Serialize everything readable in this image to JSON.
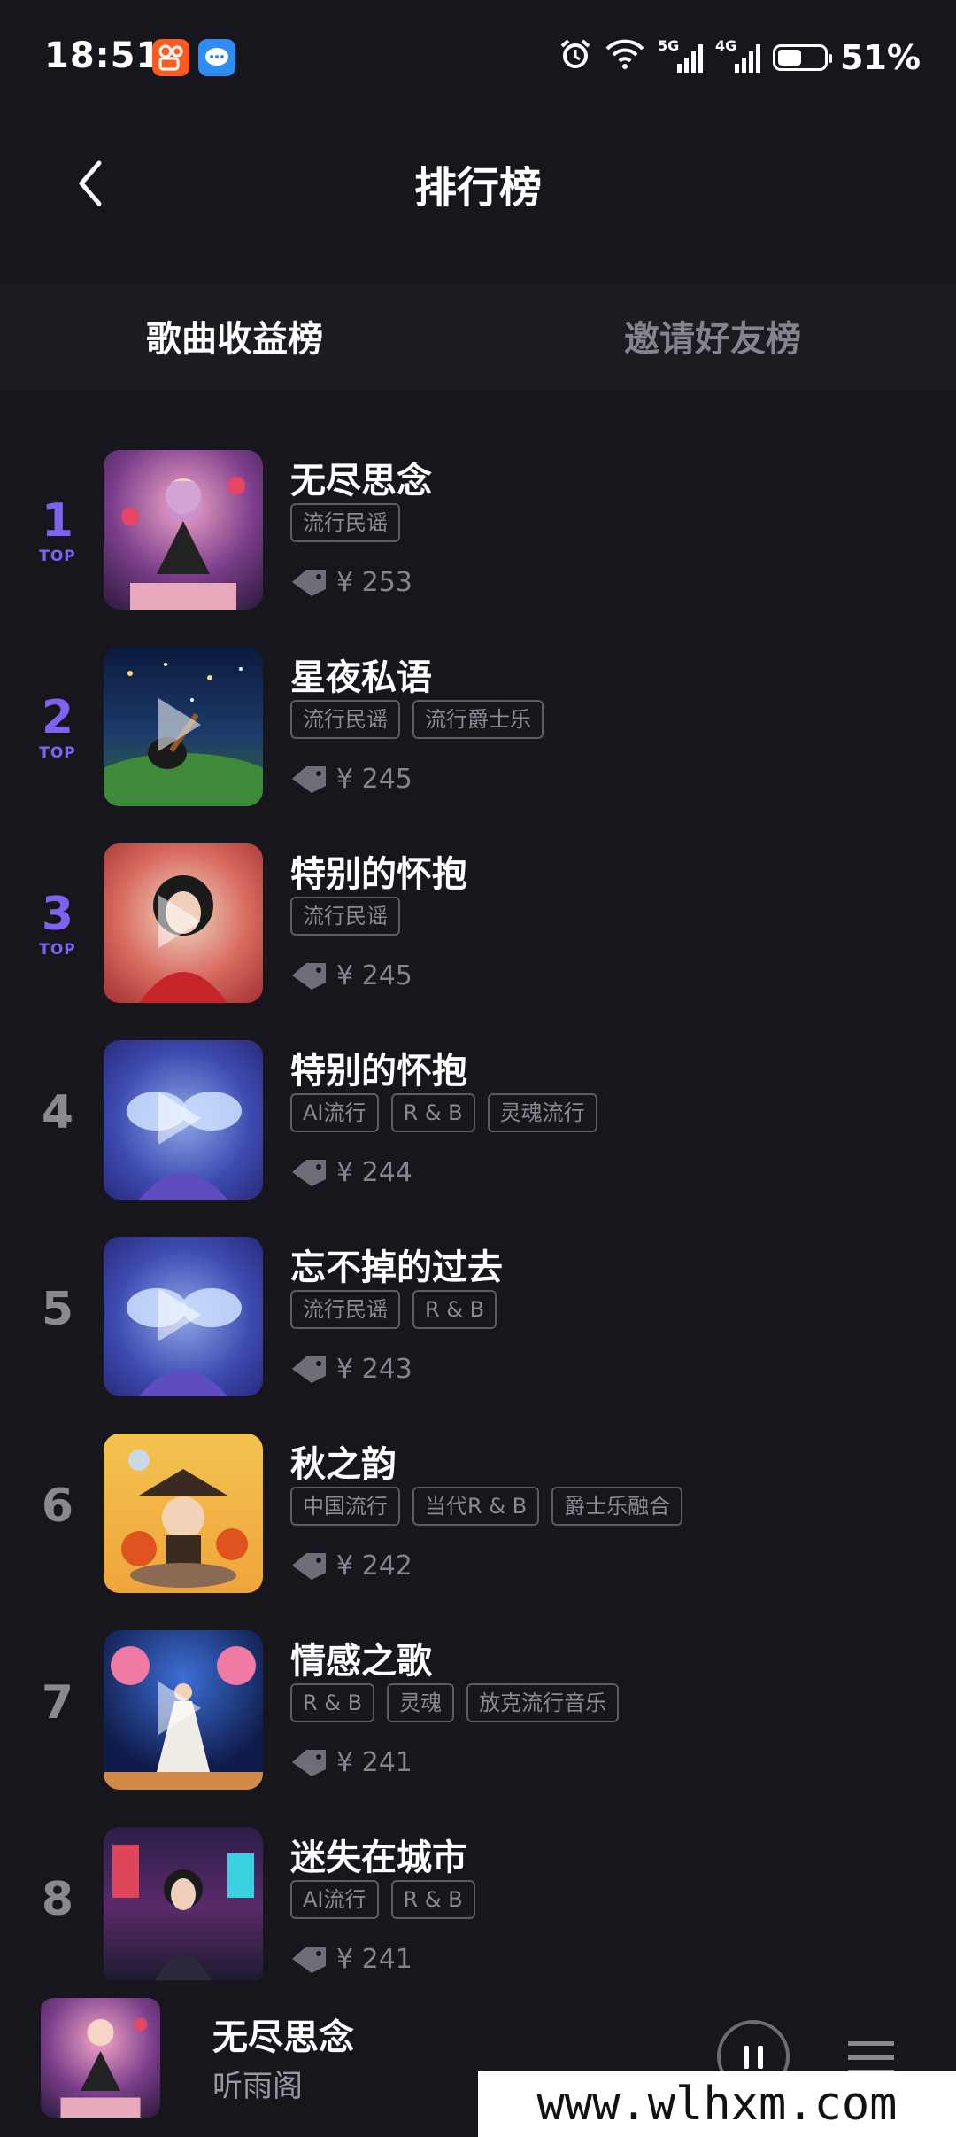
{
  "status_bar": {
    "time": "18:51",
    "battery": "51%",
    "battery_level": 0.51,
    "net1": "5G",
    "net2": "4G"
  },
  "header": {
    "title": "排行榜"
  },
  "tabs": [
    {
      "label": "歌曲收益榜",
      "active": true
    },
    {
      "label": "邀请好友榜",
      "active": false
    }
  ],
  "songs": [
    {
      "rank": "1",
      "top": "TOP",
      "title": "无尽思念",
      "tags": [
        "流行民谣"
      ],
      "price": "¥ 253"
    },
    {
      "rank": "2",
      "top": "TOP",
      "title": "星夜私语",
      "tags": [
        "流行民谣",
        "流行爵士乐"
      ],
      "price": "¥ 245"
    },
    {
      "rank": "3",
      "top": "TOP",
      "title": "特别的怀抱",
      "tags": [
        "流行民谣"
      ],
      "price": "¥ 245"
    },
    {
      "rank": "4",
      "title": "特别的怀抱",
      "tags": [
        "AI流行",
        "R & B",
        "灵魂流行"
      ],
      "price": "¥ 244"
    },
    {
      "rank": "5",
      "title": "忘不掉的过去",
      "tags": [
        "流行民谣",
        "R & B"
      ],
      "price": "¥ 243"
    },
    {
      "rank": "6",
      "title": "秋之韵",
      "tags": [
        "中国流行",
        "当代R & B",
        "爵士乐融合"
      ],
      "price": "¥ 242"
    },
    {
      "rank": "7",
      "title": "情感之歌",
      "tags": [
        "R & B",
        "灵魂",
        "放克流行音乐"
      ],
      "price": "¥ 241"
    },
    {
      "rank": "8",
      "title": "迷失在城市",
      "tags": [
        "AI流行",
        "R & B"
      ],
      "price": "¥ 241"
    }
  ],
  "mini_player": {
    "title": "无尽思念",
    "artist": "听雨阁"
  },
  "watermark": "www.wlhxm.com"
}
